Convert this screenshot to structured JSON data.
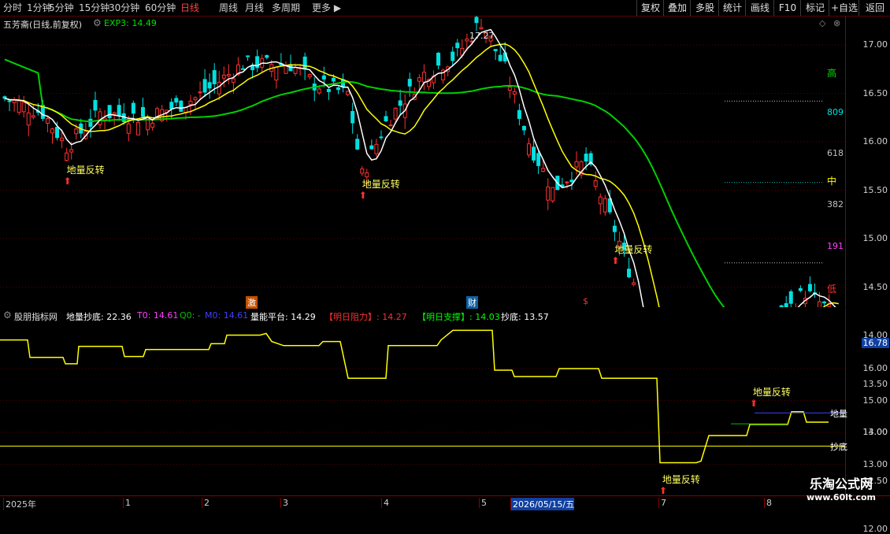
{
  "toolbar": {
    "items": [
      "分时",
      "1分钟",
      "5分钟",
      "15分钟",
      "30分钟",
      "60分钟",
      "日线",
      "周线",
      "月线",
      "多周期",
      "更多"
    ],
    "active_index": 6,
    "right_buttons": [
      "复权",
      "叠加",
      "多股",
      "统计",
      "画线",
      "F10",
      "标记",
      "+自选",
      "返回"
    ]
  },
  "main": {
    "stock_title": "五芳斋(日线,前复权)",
    "exp_label": "EXP3: 14.49",
    "peak_label": "17.27",
    "signal_label": "地量反转",
    "signals": [
      {
        "text": "地量反转",
        "i": 13
      },
      {
        "text": "地量反转",
        "i": 75
      },
      {
        "text": "地量反转",
        "i": 128
      },
      {
        "text": "地量反转",
        "i": 138
      },
      {
        "text": "地量反转",
        "i": 157
      }
    ],
    "fib_labels": {
      "high": "高",
      "l809": "809",
      "l618": "618",
      "mid": "中",
      "l382": "382",
      "l191": "191",
      "low": "低"
    },
    "y_ticks": [
      "17.00",
      "16.50",
      "16.00",
      "15.50",
      "15.00",
      "14.50",
      "14.00",
      "13.50",
      "13.00",
      "12.50",
      "12.00"
    ],
    "event_markers": [
      "激",
      "财",
      "$"
    ],
    "colors": {
      "up": "#ff3030",
      "down": "#00e0e0",
      "ma_green": "#00d000",
      "ma_yellow": "#ffff00",
      "ma_white": "#ffffff"
    }
  },
  "indicator": {
    "name": "股朋指标网",
    "legend": [
      {
        "text": "地量抄底: 22.36",
        "color": "#ffffff"
      },
      {
        "text": "T0: 14.61",
        "color": "#ff40ff"
      },
      {
        "text": "Q0: -",
        "color": "#00c000"
      },
      {
        "text": "M0: 14.61",
        "color": "#4040ff"
      },
      {
        "text": "量能平台: 14.29",
        "color": "#ffffff"
      },
      {
        "text": "【明日阻力】: 14.27",
        "color": "#ff3030"
      },
      {
        "text": "【明日支撑】: 14.03",
        "color": "#00ff00"
      },
      {
        "text": "抄底: 13.57",
        "color": "#ffffff"
      }
    ],
    "y_ticks": [
      "16.78",
      "16.00",
      "15.00",
      "14.00",
      "13.00"
    ],
    "right_labels": {
      "dlz": "地量",
      "chaodi": "抄底"
    }
  },
  "bottom_axis": {
    "labels": [
      "2025年",
      "1",
      "2",
      "3",
      "4",
      "5",
      "2026/05/15/五",
      "7",
      "8"
    ]
  },
  "watermark": {
    "title": "乐淘公式网",
    "url": "www.60lt.com"
  }
}
